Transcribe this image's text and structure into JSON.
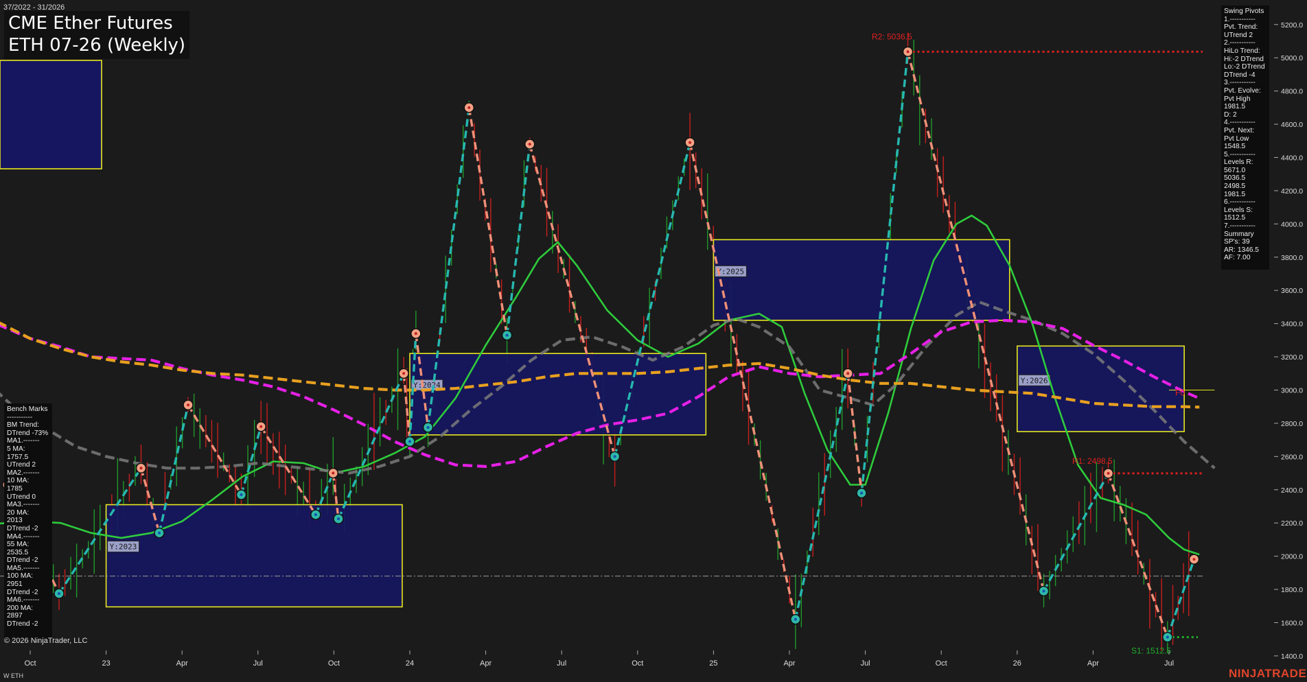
{
  "header": {
    "date_range": "37/2022 - 31/2026",
    "title_line1": "CME Ether Futures",
    "title_line2": "ETH 07-26 (Weekly)"
  },
  "swing_panel": {
    "lines": [
      "Swing Pivots",
      "1.-----------",
      "Pvt. Trend:",
      "UTrend 2",
      "2.-----------",
      "HiLo Trend:",
      "Hi:-2 DTrend",
      "Lo:-2 DTrend",
      "DTrend -4",
      "3.-----------",
      "Pvt. Evolve:",
      "Pvt High",
      "1981.5",
      "D: 2",
      "4.-----------",
      "Pvt. Next:",
      "Pvt Low",
      "1548.5",
      "5.-----------",
      "Levels R:",
      "5671.0",
      "5036.5",
      "2498.5",
      "1981.5",
      "6.-----------",
      "Levels S:",
      "1512.5",
      "7.-----------",
      "Summary",
      "SP's: 39",
      "AR: 1346.5",
      "AF: 7.00"
    ]
  },
  "bench_panel": {
    "lines": [
      "Bench Marks",
      "-----------",
      "BM Trend:",
      "DTrend -73%",
      "MA1.-------",
      "5 MA:",
      "1757.5",
      "UTrend 2",
      "MA2.-------",
      "10 MA:",
      "1785",
      "UTrend 0",
      "MA3.-------",
      "20 MA:",
      "2013",
      "DTrend -2",
      "MA4.-------",
      "55 MA:",
      "2535.5",
      "DTrend -2",
      "MA5.-------",
      "100 MA:",
      "2951",
      "DTrend -2",
      "MA6.-------",
      "200 MA:",
      "2897",
      "DTrend -2"
    ]
  },
  "copyright": "© 2026 NinjaTrader, LLC",
  "footer_left": "W ETH",
  "brand": "NINJATRADER",
  "chart_data": {
    "type": "line",
    "instrument": "ETH 07-26",
    "timeframe": "Weekly",
    "y_axis": {
      "ticks": [
        1400,
        1600,
        1800,
        2000,
        2200,
        2400,
        2600,
        2800,
        3000,
        3200,
        3400,
        3600,
        3800,
        4000,
        4200,
        4400,
        4600,
        4800,
        5000,
        5200
      ],
      "range": [
        1284,
        5290
      ]
    },
    "x_axis": {
      "labels": [
        "Oct",
        "23",
        "Apr",
        "Jul",
        "Oct",
        "24",
        "Apr",
        "Jul",
        "Oct",
        "25",
        "Apr",
        "Jul",
        "Oct",
        "26",
        "Apr",
        "Jul"
      ],
      "label_positions": [
        0,
        1,
        2,
        3,
        4,
        5,
        6,
        7,
        8,
        9,
        10,
        11,
        12,
        13,
        14,
        15
      ]
    },
    "level_labels": [
      {
        "text": "R2: 5036.5",
        "value": 5036.5,
        "color": "#e02020"
      },
      {
        "text": "R1: 2498.5",
        "value": 2498.5,
        "color": "#e02020"
      },
      {
        "text": "S1: 1512.5",
        "value": 1512.5,
        "color": "#1fae2c"
      },
      {
        "text": "F0",
        "value": 3000,
        "color": "#e02020"
      }
    ],
    "year_boxes": [
      {
        "label": "Y:2023",
        "x_start": 1.0,
        "x_end": 4.9,
        "high": 2310,
        "low": 1695
      },
      {
        "label": "Y:2024",
        "x_start": 5.0,
        "x_end": 8.9,
        "high": 3220,
        "low": 2730
      },
      {
        "label": "Y:2025",
        "x_start": 9.0,
        "x_end": 12.9,
        "high": 3905,
        "low": 3420
      },
      {
        "label": "Y:2026",
        "x_start": 13.0,
        "x_end": 15.2,
        "high": 3265,
        "low": 2750
      }
    ],
    "swing_pivots": [
      {
        "x": -0.3,
        "y": 2430,
        "type": "high"
      },
      {
        "x": 0.38,
        "y": 1775,
        "type": "low"
      },
      {
        "x": 1.46,
        "y": 2530,
        "type": "high"
      },
      {
        "x": 1.7,
        "y": 2140,
        "type": "low"
      },
      {
        "x": 2.08,
        "y": 2910,
        "type": "high"
      },
      {
        "x": 2.78,
        "y": 2370,
        "type": "low"
      },
      {
        "x": 3.04,
        "y": 2780,
        "type": "high"
      },
      {
        "x": 3.76,
        "y": 2250,
        "type": "low"
      },
      {
        "x": 3.99,
        "y": 2500,
        "type": "high"
      },
      {
        "x": 4.06,
        "y": 2225,
        "type": "low"
      },
      {
        "x": 4.92,
        "y": 3100,
        "type": "high"
      },
      {
        "x": 5.0,
        "y": 2690,
        "type": "low"
      },
      {
        "x": 5.08,
        "y": 3340,
        "type": "high"
      },
      {
        "x": 5.24,
        "y": 2775,
        "type": "low"
      },
      {
        "x": 5.78,
        "y": 4700,
        "type": "high"
      },
      {
        "x": 6.28,
        "y": 3330,
        "type": "low"
      },
      {
        "x": 6.58,
        "y": 4480,
        "type": "high"
      },
      {
        "x": 7.7,
        "y": 2600,
        "type": "low"
      },
      {
        "x": 8.69,
        "y": 4490,
        "type": "high"
      },
      {
        "x": 10.08,
        "y": 1620,
        "type": "low"
      },
      {
        "x": 10.77,
        "y": 3100,
        "type": "high"
      },
      {
        "x": 10.95,
        "y": 2380,
        "type": "low"
      },
      {
        "x": 11.56,
        "y": 5036.5,
        "type": "high"
      },
      {
        "x": 13.35,
        "y": 1790,
        "type": "low"
      },
      {
        "x": 14.2,
        "y": 2498.5,
        "type": "high"
      },
      {
        "x": 14.98,
        "y": 1512.5,
        "type": "low"
      },
      {
        "x": 15.33,
        "y": 1981.5,
        "type": "high"
      }
    ],
    "series": [
      {
        "color": "#2ecc3c",
        "points": [
          [
            -0.6,
            2190
          ],
          [
            0.0,
            2210
          ],
          [
            0.4,
            2200
          ],
          [
            0.8,
            2140
          ],
          [
            1.2,
            2110
          ],
          [
            1.6,
            2140
          ],
          [
            2.0,
            2210
          ],
          [
            2.4,
            2340
          ],
          [
            2.8,
            2480
          ],
          [
            3.2,
            2570
          ],
          [
            3.6,
            2560
          ],
          [
            4.0,
            2500
          ],
          [
            4.4,
            2540
          ],
          [
            4.8,
            2620
          ],
          [
            5.2,
            2720
          ],
          [
            5.6,
            2950
          ],
          [
            6.0,
            3270
          ],
          [
            6.4,
            3560
          ],
          [
            6.7,
            3790
          ],
          [
            6.95,
            3890
          ],
          [
            7.2,
            3750
          ],
          [
            7.6,
            3480
          ],
          [
            8.0,
            3300
          ],
          [
            8.4,
            3200
          ],
          [
            8.8,
            3280
          ],
          [
            9.2,
            3420
          ],
          [
            9.6,
            3460
          ],
          [
            9.9,
            3380
          ],
          [
            10.2,
            2980
          ],
          [
            10.5,
            2640
          ],
          [
            10.8,
            2430
          ],
          [
            11.0,
            2430
          ],
          [
            11.3,
            2860
          ],
          [
            11.6,
            3370
          ],
          [
            11.9,
            3780
          ],
          [
            12.2,
            4000
          ],
          [
            12.4,
            4050
          ],
          [
            12.6,
            3990
          ],
          [
            12.9,
            3750
          ],
          [
            13.2,
            3400
          ],
          [
            13.5,
            2950
          ],
          [
            13.8,
            2550
          ],
          [
            14.1,
            2350
          ],
          [
            14.4,
            2310
          ],
          [
            14.7,
            2250
          ],
          [
            15.0,
            2110
          ],
          [
            15.2,
            2040
          ],
          [
            15.4,
            2010
          ]
        ]
      },
      {
        "color": "#7a7a7a",
        "points": [
          [
            -0.6,
            3060
          ],
          [
            -0.2,
            2890
          ],
          [
            0.2,
            2770
          ],
          [
            0.6,
            2660
          ],
          [
            1.0,
            2600
          ],
          [
            1.4,
            2560
          ],
          [
            1.8,
            2530
          ],
          [
            2.2,
            2530
          ],
          [
            2.6,
            2540
          ],
          [
            3.0,
            2560
          ],
          [
            3.4,
            2540
          ],
          [
            3.8,
            2520
          ],
          [
            4.2,
            2500
          ],
          [
            4.6,
            2540
          ],
          [
            5.0,
            2600
          ],
          [
            5.4,
            2720
          ],
          [
            5.8,
            2880
          ],
          [
            6.2,
            3020
          ],
          [
            6.6,
            3180
          ],
          [
            7.0,
            3300
          ],
          [
            7.4,
            3320
          ],
          [
            7.8,
            3260
          ],
          [
            8.2,
            3180
          ],
          [
            8.6,
            3260
          ],
          [
            9.0,
            3390
          ],
          [
            9.3,
            3430
          ],
          [
            9.6,
            3380
          ],
          [
            10.0,
            3260
          ],
          [
            10.4,
            3000
          ],
          [
            10.8,
            2950
          ],
          [
            11.1,
            2910
          ],
          [
            11.4,
            3030
          ],
          [
            11.8,
            3260
          ],
          [
            12.2,
            3450
          ],
          [
            12.5,
            3530
          ],
          [
            12.8,
            3480
          ],
          [
            13.2,
            3420
          ],
          [
            13.6,
            3340
          ],
          [
            14.0,
            3220
          ],
          [
            14.4,
            3060
          ],
          [
            14.8,
            2880
          ],
          [
            15.2,
            2690
          ],
          [
            15.6,
            2530
          ]
        ]
      },
      {
        "color": "#e620e6",
        "points": [
          [
            -0.6,
            3430
          ],
          [
            0.0,
            3310
          ],
          [
            0.4,
            3260
          ],
          [
            0.8,
            3200
          ],
          [
            1.2,
            3190
          ],
          [
            1.6,
            3180
          ],
          [
            2.0,
            3130
          ],
          [
            2.4,
            3090
          ],
          [
            2.8,
            3060
          ],
          [
            3.2,
            3020
          ],
          [
            3.6,
            2960
          ],
          [
            4.0,
            2880
          ],
          [
            4.4,
            2790
          ],
          [
            4.8,
            2690
          ],
          [
            5.2,
            2610
          ],
          [
            5.6,
            2550
          ],
          [
            6.0,
            2540
          ],
          [
            6.4,
            2570
          ],
          [
            6.8,
            2660
          ],
          [
            7.2,
            2740
          ],
          [
            7.6,
            2790
          ],
          [
            8.0,
            2820
          ],
          [
            8.4,
            2860
          ],
          [
            8.8,
            2960
          ],
          [
            9.2,
            3080
          ],
          [
            9.6,
            3140
          ],
          [
            10.0,
            3100
          ],
          [
            10.4,
            3080
          ],
          [
            10.8,
            3090
          ],
          [
            11.2,
            3100
          ],
          [
            11.6,
            3220
          ],
          [
            12.0,
            3350
          ],
          [
            12.4,
            3410
          ],
          [
            12.8,
            3420
          ],
          [
            13.2,
            3410
          ],
          [
            13.6,
            3370
          ],
          [
            14.0,
            3270
          ],
          [
            14.4,
            3180
          ],
          [
            14.8,
            3080
          ],
          [
            15.2,
            2990
          ],
          [
            15.4,
            2950
          ]
        ]
      },
      {
        "color": "#e8a020",
        "points": [
          [
            -0.6,
            3450
          ],
          [
            0.0,
            3310
          ],
          [
            0.4,
            3250
          ],
          [
            0.8,
            3200
          ],
          [
            1.2,
            3170
          ],
          [
            1.6,
            3150
          ],
          [
            2.0,
            3120
          ],
          [
            2.4,
            3100
          ],
          [
            2.8,
            3090
          ],
          [
            3.2,
            3070
          ],
          [
            3.6,
            3050
          ],
          [
            4.0,
            3030
          ],
          [
            4.4,
            3010
          ],
          [
            4.8,
            3000
          ],
          [
            5.2,
            3000
          ],
          [
            5.6,
            3010
          ],
          [
            6.0,
            3030
          ],
          [
            6.4,
            3050
          ],
          [
            6.8,
            3080
          ],
          [
            7.2,
            3100
          ],
          [
            7.6,
            3100
          ],
          [
            8.0,
            3100
          ],
          [
            8.4,
            3110
          ],
          [
            8.8,
            3130
          ],
          [
            9.2,
            3150
          ],
          [
            9.6,
            3160
          ],
          [
            10.0,
            3130
          ],
          [
            10.4,
            3090
          ],
          [
            10.8,
            3060
          ],
          [
            11.2,
            3040
          ],
          [
            11.6,
            3040
          ],
          [
            12.0,
            3020
          ],
          [
            12.4,
            3000
          ],
          [
            12.8,
            2990
          ],
          [
            13.2,
            2980
          ],
          [
            13.6,
            2950
          ],
          [
            14.0,
            2920
          ],
          [
            14.4,
            2910
          ],
          [
            14.8,
            2900
          ],
          [
            15.2,
            2900
          ],
          [
            15.4,
            2897
          ]
        ]
      }
    ]
  }
}
